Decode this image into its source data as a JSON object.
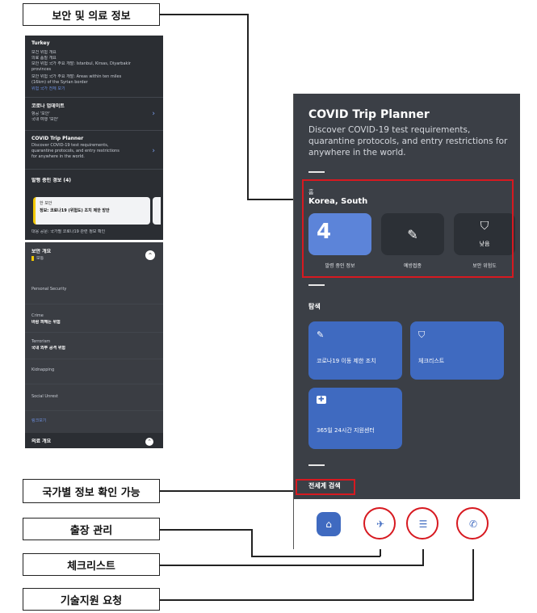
{
  "callouts": {
    "security_medical": "보안 및 의료 정보",
    "country_info": "국가별 정보 확인 가능",
    "trip_management": "출장 관리",
    "checklist": "체크리스트",
    "tech_support": "기술지원 요청"
  },
  "shot1": {
    "country": "Turkey",
    "bullets": [
      "보건 위험 개요",
      "의료 품질 개요",
      "보안 위험 국가 주요 개발: Istanbul, Kirsas, Diyarbakir",
      "provinces",
      "보안 위험 국가 주요 개발: Areas within ten miles",
      "(16km) of the Syrian border",
      "위험 국가 전체 보기"
    ],
    "covid_header": "코로나 업데이트",
    "covid_rows": [
      "항공 '보안'",
      "국내 여행 '보안'"
    ],
    "planner_title": "COVID Trip Planner",
    "planner_desc": [
      "Discover COVID-19 test requirements,",
      "quarantine protocols, and entry restrictions",
      "for anywhere in the world."
    ],
    "alerts_header": "발행 중인 경보 (4)",
    "alert_card": [
      "한 보안",
      "정보: 코로나19 (위험도) 조치 제한 방안"
    ],
    "alert_card2": "대응 공문: 국가별 코로나19 관련 정보 확인"
  },
  "shot2": {
    "header": "보안 개요",
    "level": "보통",
    "items": [
      "Personal Security",
      "Crime",
      "바람 피해는 위험",
      "Terrorism",
      "국내 외부 공격 위험",
      "Kidnapping",
      "Social Unrest",
      "링크보기"
    ],
    "footer": "의료 개요"
  },
  "phone": {
    "title": "COVID Trip Planner",
    "desc": "Discover COVID-19 test requirements, quarantine protocols, and entry restrictions for anywhere in the world.",
    "region_label": "홈",
    "country": "Korea, South",
    "alerts_count": "4",
    "tile_caps": [
      "발령 중인 정보",
      "예방접종",
      "보안 위험도"
    ],
    "security_level": "낮음",
    "explore_title": "탐색",
    "cards": [
      "코로나19 이동 제한 조치",
      "체크리스트",
      "365일 24시간 지원센터"
    ],
    "global_search": "전세계 검색"
  },
  "colors": {
    "accent_red": "#d71920",
    "tile_blue": "#5c84d9",
    "card_blue": "#3f6ac0",
    "phone_bg": "#3b3f46"
  }
}
